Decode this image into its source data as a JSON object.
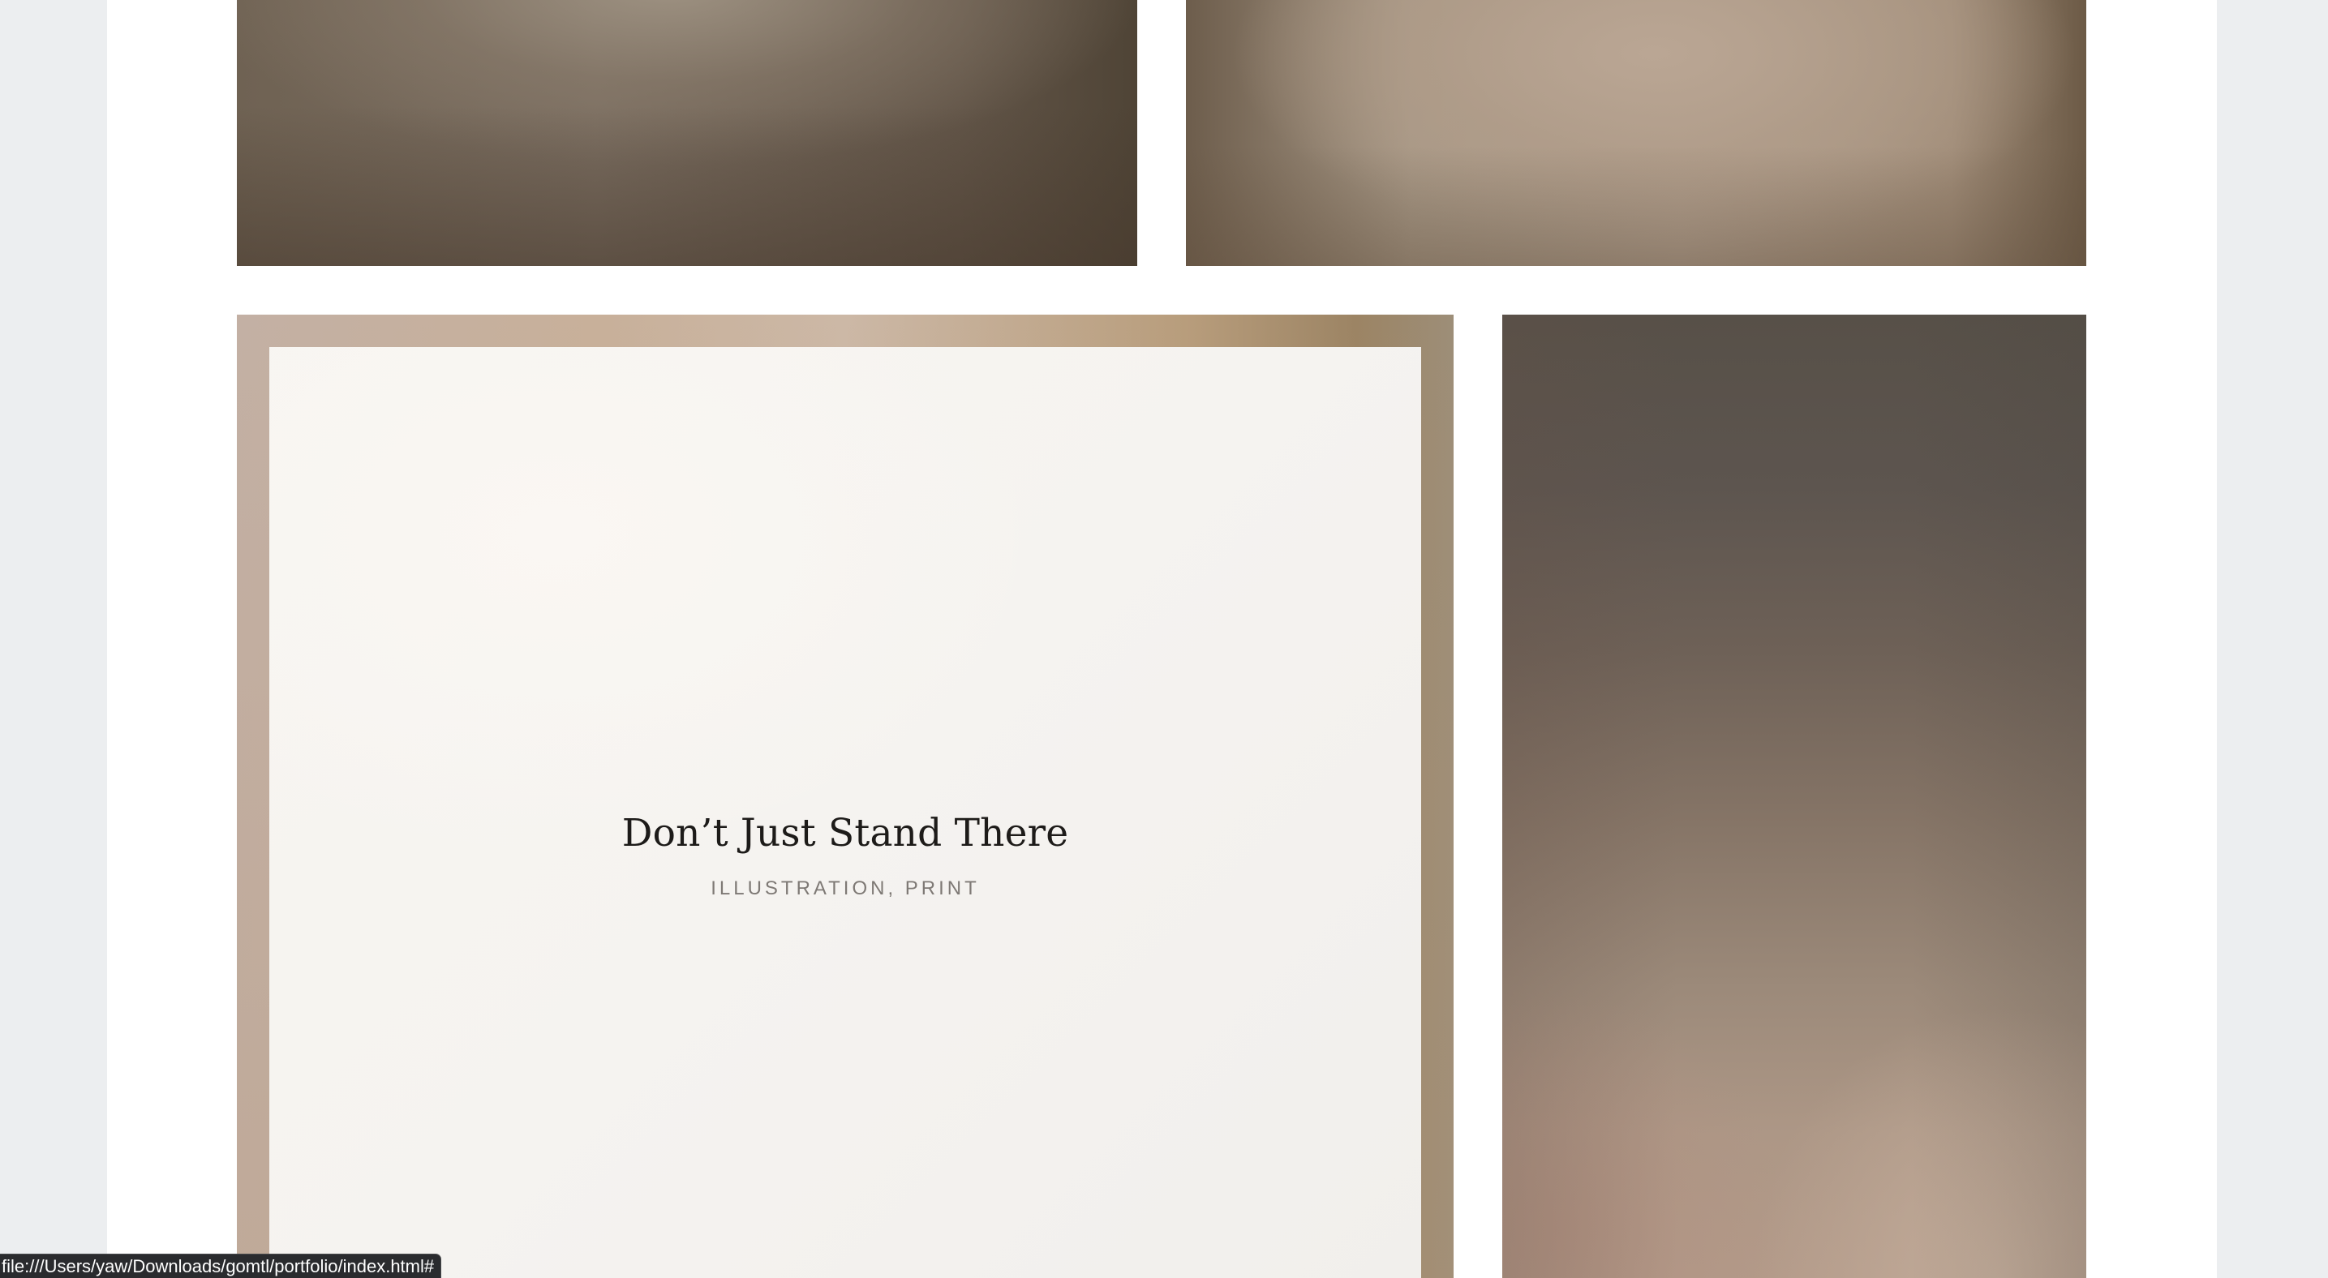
{
  "portfolio": {
    "tiles": [
      {
        "id": "top-left",
        "kind": "image"
      },
      {
        "id": "top-right",
        "kind": "image"
      },
      {
        "id": "featured",
        "kind": "project",
        "title": "Don’t Just Stand There",
        "meta": "ILLUSTRATION, PRINT"
      },
      {
        "id": "portrait",
        "kind": "image"
      }
    ]
  },
  "status_bar": {
    "url": "file:///Users/yaw/Downloads/gomtl/portfolio/index.html#"
  },
  "colors": {
    "page_background": "#eceef0",
    "sheet": "#ffffff",
    "mat": "#f5f3f0",
    "title_text": "#1d1b19",
    "meta_text": "#7e7975",
    "status_bar": "#2a2b2e"
  }
}
